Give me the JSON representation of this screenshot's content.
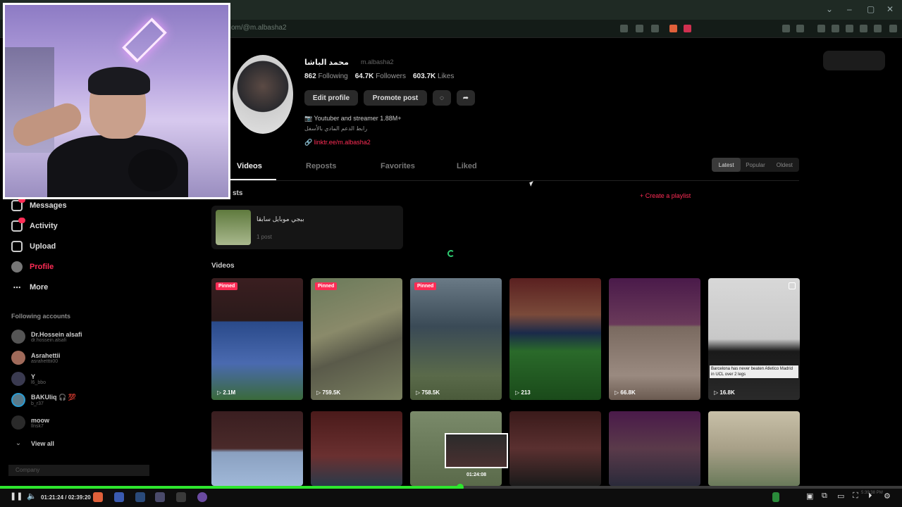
{
  "browser": {
    "url": "om/@m.albasha2"
  },
  "sidebar": {
    "items": [
      {
        "label": "Messages",
        "icon": "message-icon"
      },
      {
        "label": "Activity",
        "icon": "activity-icon"
      },
      {
        "label": "Upload",
        "icon": "upload-icon"
      },
      {
        "label": "Profile",
        "icon": "profile-icon"
      },
      {
        "label": "More",
        "icon": "more-icon"
      }
    ],
    "following_title": "Following accounts",
    "accounts": [
      {
        "name": "Dr.Hossein alsafi",
        "handle": "dr.hossein.alsafi"
      },
      {
        "name": "Asrahettii",
        "handle": "asrahetttii00"
      },
      {
        "name": "Y",
        "handle": "l6_bbo"
      },
      {
        "name": "BAKUliq 🎧 💯",
        "handle": "b_r37"
      },
      {
        "name": "moow",
        "handle": "llnsk7"
      }
    ],
    "view_all": "View all",
    "company": "Company"
  },
  "profile": {
    "name": "محمد الباشا",
    "handle": "m.albasha2",
    "following_count": "862",
    "following_label": "Following",
    "followers_count": "64.7K",
    "followers_label": "Followers",
    "likes_count": "603.7K",
    "likes_label": "Likes",
    "edit_label": "Edit profile",
    "promote_label": "Promote post",
    "bio": "📷 Youtuber and streamer 1.88M+",
    "bio_line2": "رابط الدعم المادي بالأسفل",
    "link": "🔗 linktr.ee/m.albasha2"
  },
  "tabs": [
    "Videos",
    "Reposts",
    "Favorites",
    "Liked"
  ],
  "sort": [
    "Latest",
    "Popular",
    "Oldest"
  ],
  "playlists_label": "sts",
  "create_playlist": "+ Create a playlist",
  "playlist": {
    "title": "ببجي موبايل سابقا",
    "count": "1 post"
  },
  "videos_label": "Videos",
  "videos_row1": [
    {
      "pinned": "Pinned",
      "views": "2.1M"
    },
    {
      "pinned": "Pinned",
      "views": "759.5K"
    },
    {
      "pinned": "Pinned",
      "views": "758.5K"
    },
    {
      "pinned": "",
      "views": "213"
    },
    {
      "pinned": "",
      "views": "66.8K"
    },
    {
      "pinned": "",
      "views": "16.8K"
    }
  ],
  "video6_caption": "Barcelona has never beaten Atletico Madrid in UCL over 2 legs",
  "preview_time": "01:24:08",
  "player": {
    "time": "01:21:24 / 02:39:20",
    "progress": 0.51,
    "accent": "#2ee62e"
  },
  "clock": "5:39:38 PM"
}
